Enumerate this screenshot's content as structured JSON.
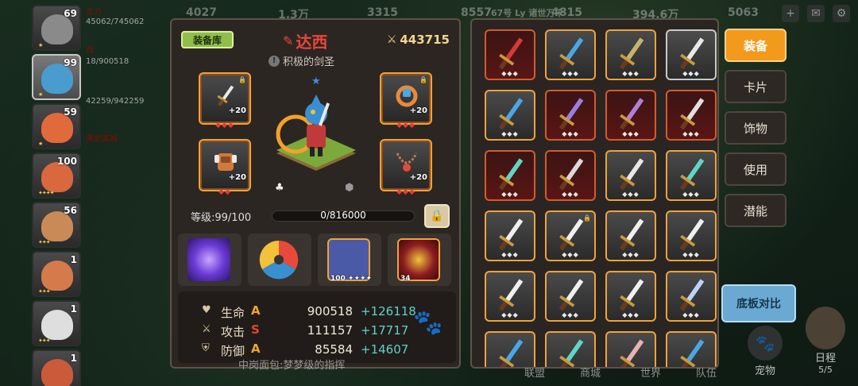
{
  "topbar": {
    "resources": [
      "4027",
      "1.3万",
      "3315",
      "8557",
      "4815",
      "394.6万",
      "5063"
    ],
    "announce": "67号 Ly 诸世万千",
    "right_icon_plus": "+",
    "right_icon_mail": "✉",
    "right_icon_gear": "⚙"
  },
  "hero_list": [
    {
      "level": "69",
      "stars": "★",
      "face_color": "#8a8a8a"
    },
    {
      "level": "99",
      "stars": "★",
      "face_color": "#4a9ccf"
    },
    {
      "level": "59",
      "stars": "★",
      "face_color": "#e06a3c"
    },
    {
      "level": "100",
      "stars": "✦✦✦✦",
      "face_color": "#d9683e"
    },
    {
      "level": "56",
      "stars": "✦✦✦",
      "face_color": "#c98a58"
    },
    {
      "level": "1",
      "stars": "✦✦✦",
      "face_color": "#d57a4a"
    },
    {
      "level": "1",
      "stars": "✦✦✦",
      "face_color": "#dedede"
    },
    {
      "level": "1",
      "stars": "✦✦✦",
      "face_color": "#c95a3a"
    }
  ],
  "hero_ghost_text": [
    "古力",
    "45062/745062",
    "西",
    "18/900518",
    "42259/942259",
    "黑史莱姆"
  ],
  "detail": {
    "library_label": "装备库",
    "name": "达西",
    "power": "443715",
    "title": "积极的剑圣",
    "gear": [
      {
        "plus": "+20",
        "pips": "◆◆◆",
        "locked": true
      },
      {
        "plus": "+20",
        "pips": "◆◆◆",
        "locked": true
      },
      {
        "plus": "+20",
        "pips": "◆◆",
        "locked": false
      },
      {
        "plus": "+20",
        "pips": "◆◆◆",
        "locked": false
      }
    ],
    "level_label": "等级:99/100",
    "xp_text": "0/816000",
    "xp_fraction": 0,
    "skills": [
      {
        "badge": "",
        "color": "#6b3ad6"
      },
      {
        "badge": "",
        "color": "#3a3431"
      },
      {
        "badge": "100 ✦✦✦✦",
        "color": "#4b5aa7"
      },
      {
        "badge": "34",
        "color": "#8c1c22"
      }
    ],
    "stats": [
      {
        "label": "生命",
        "grade": "A",
        "grade_color": "#f0a52a",
        "value": "900518",
        "bonus": "+126118",
        "icon": "♥"
      },
      {
        "label": "攻击",
        "grade": "S",
        "grade_color": "#e0482e",
        "value": "111157",
        "bonus": "+17717",
        "icon": "⚔"
      },
      {
        "label": "防御",
        "grade": "A",
        "grade_color": "#f0a52a",
        "value": "85584",
        "bonus": "+14607",
        "icon": "⛨"
      }
    ]
  },
  "inventory": [
    {
      "style": "red",
      "blade": "#d43a3a"
    },
    {
      "style": "gold",
      "blade": "#4aa7e6"
    },
    {
      "style": "gold",
      "blade": "#c7b26b"
    },
    {
      "style": "plain",
      "blade": "#e8e8e8"
    },
    {
      "style": "gold",
      "blade": "#4aa7e6"
    },
    {
      "style": "red",
      "blade": "#9a7fe0"
    },
    {
      "style": "red",
      "blade": "#b07fd6"
    },
    {
      "style": "red",
      "blade": "#e0e0e0"
    },
    {
      "style": "red",
      "blade": "#5fd6c7"
    },
    {
      "style": "red",
      "blade": "#d9d9d9"
    },
    {
      "style": "gold",
      "blade": "#e8e8e8"
    },
    {
      "style": "gold",
      "blade": "#5fd6c7"
    },
    {
      "style": "gold",
      "blade": "#f0f0f0"
    },
    {
      "style": "gold",
      "blade": "#f0f0f0",
      "locked": true
    },
    {
      "style": "gold",
      "blade": "#f0f0f0"
    },
    {
      "style": "gold",
      "blade": "#f0f0f0"
    },
    {
      "style": "gold",
      "blade": "#f0f0f0"
    },
    {
      "style": "gold",
      "blade": "#f0f0f0"
    },
    {
      "style": "gold",
      "blade": "#f0f0f0"
    },
    {
      "style": "gold",
      "blade": "#bcd4f5"
    },
    {
      "style": "gold",
      "blade": "#4aa7e6"
    },
    {
      "style": "gold",
      "blade": "#5fd6c7"
    },
    {
      "style": "gold",
      "blade": "#e8b3b3"
    },
    {
      "style": "gold",
      "blade": "#4aa7e6"
    }
  ],
  "tabs": [
    "装备",
    "卡片",
    "饰物",
    "使用",
    "潜能"
  ],
  "compare_label": "底板对比",
  "dock": {
    "items": [
      "联盟",
      "商城",
      "世界",
      "队伍"
    ],
    "pet_label": "宠物",
    "schedule_label": "日程",
    "schedule_count": "5/5",
    "quest_text": "中岗面包:梦梦级的指挥"
  }
}
